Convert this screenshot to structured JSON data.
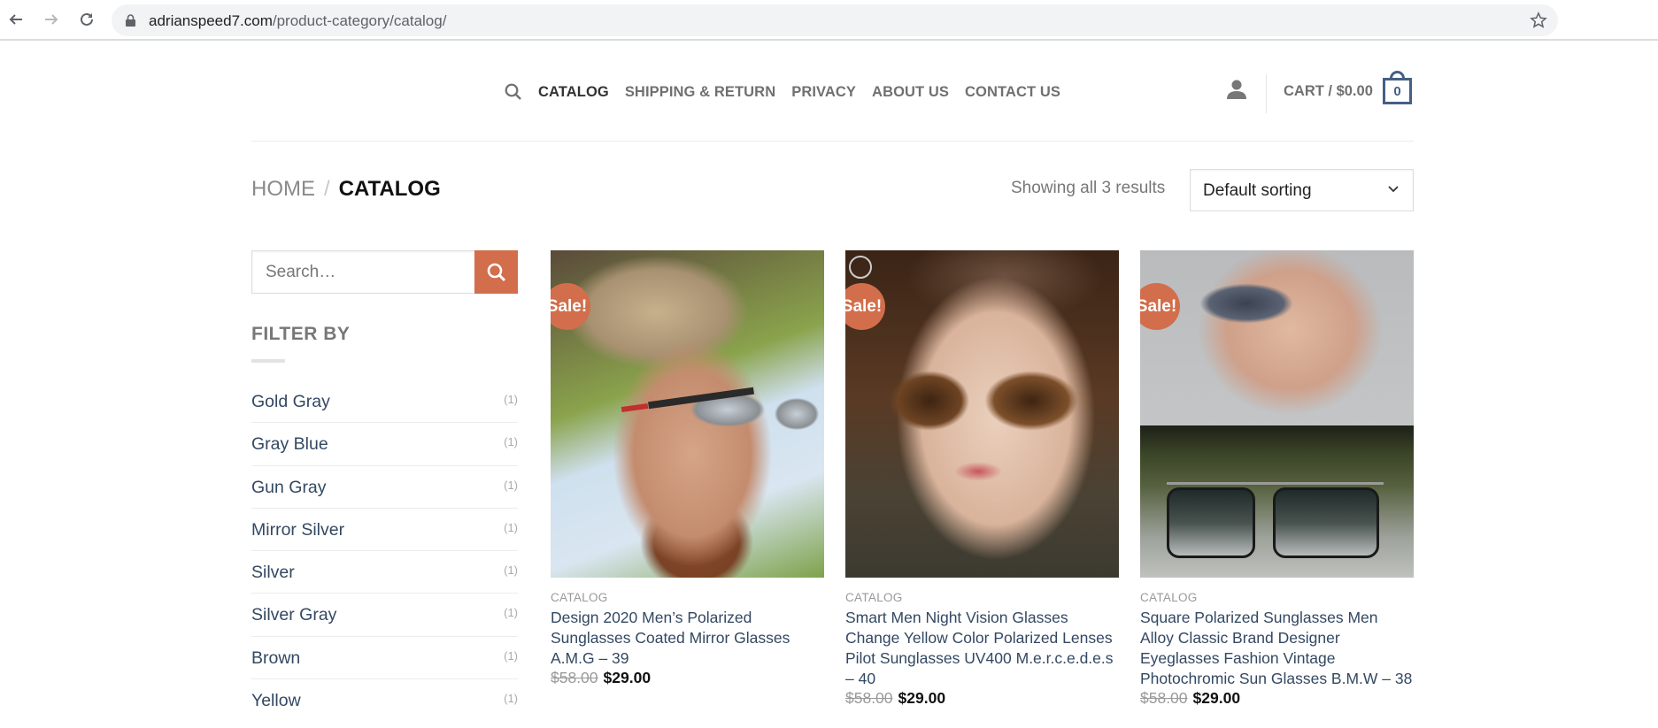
{
  "browser": {
    "url_domain": "adrianspeed7.com",
    "url_path": "/product-category/catalog/",
    "icons": [
      "back-arrow-icon",
      "forward-arrow-icon",
      "reload-icon",
      "lock-icon",
      "bookmark-star-icon"
    ]
  },
  "header": {
    "nav": [
      {
        "label": "CATALOG",
        "active": true
      },
      {
        "label": "SHIPPING & RETURN",
        "active": false
      },
      {
        "label": "PRIVACY",
        "active": false
      },
      {
        "label": "ABOUT US",
        "active": false
      },
      {
        "label": "CONTACT US",
        "active": false
      }
    ],
    "cart_label": "CART / $0.00",
    "cart_count": "0",
    "accent_color": "#446084"
  },
  "breadcrumb": {
    "home": "HOME",
    "separator": "/",
    "current": "CATALOG"
  },
  "toolbar": {
    "results": "Showing all 3 results",
    "sort_selected": "Default sorting"
  },
  "sidebar": {
    "search_placeholder": "Search…",
    "search_button_color": "#d26e4b",
    "filter_title": "FILTER BY",
    "filters": [
      {
        "name": "Gold Gray",
        "count": "(1)"
      },
      {
        "name": "Gray Blue",
        "count": "(1)"
      },
      {
        "name": "Gun Gray",
        "count": "(1)"
      },
      {
        "name": "Mirror Silver",
        "count": "(1)"
      },
      {
        "name": "Silver",
        "count": "(1)"
      },
      {
        "name": "Silver Gray",
        "count": "(1)"
      },
      {
        "name": "Brown",
        "count": "(1)"
      },
      {
        "name": "Yellow",
        "count": "(1)"
      }
    ]
  },
  "products": [
    {
      "badge": "Sale!",
      "category": "CATALOG",
      "title": "Design 2020 Men’s Polarized Sunglasses Coated Mirror Glasses A.M.G – 39",
      "old_price": "$58.00",
      "price": "$29.00"
    },
    {
      "badge": "Sale!",
      "category": "CATALOG",
      "title": "Smart Men Night Vision Glasses Change Yellow Color Polarized Lenses Pilot Sunglasses UV400 M.e.r.c.e.d.e.s – 40",
      "old_price": "$58.00",
      "price": "$29.00"
    },
    {
      "badge": "Sale!",
      "category": "CATALOG",
      "title": "Square Polarized Sunglasses Men Alloy Classic Brand Designer Eyeglasses Fashion Vintage Photochromic Sun Glasses B.M.W – 38",
      "old_price": "$58.00",
      "price": "$29.00"
    }
  ],
  "colors": {
    "sale_badge": "#d26e4b",
    "link": "#334862",
    "muted": "#777777"
  }
}
